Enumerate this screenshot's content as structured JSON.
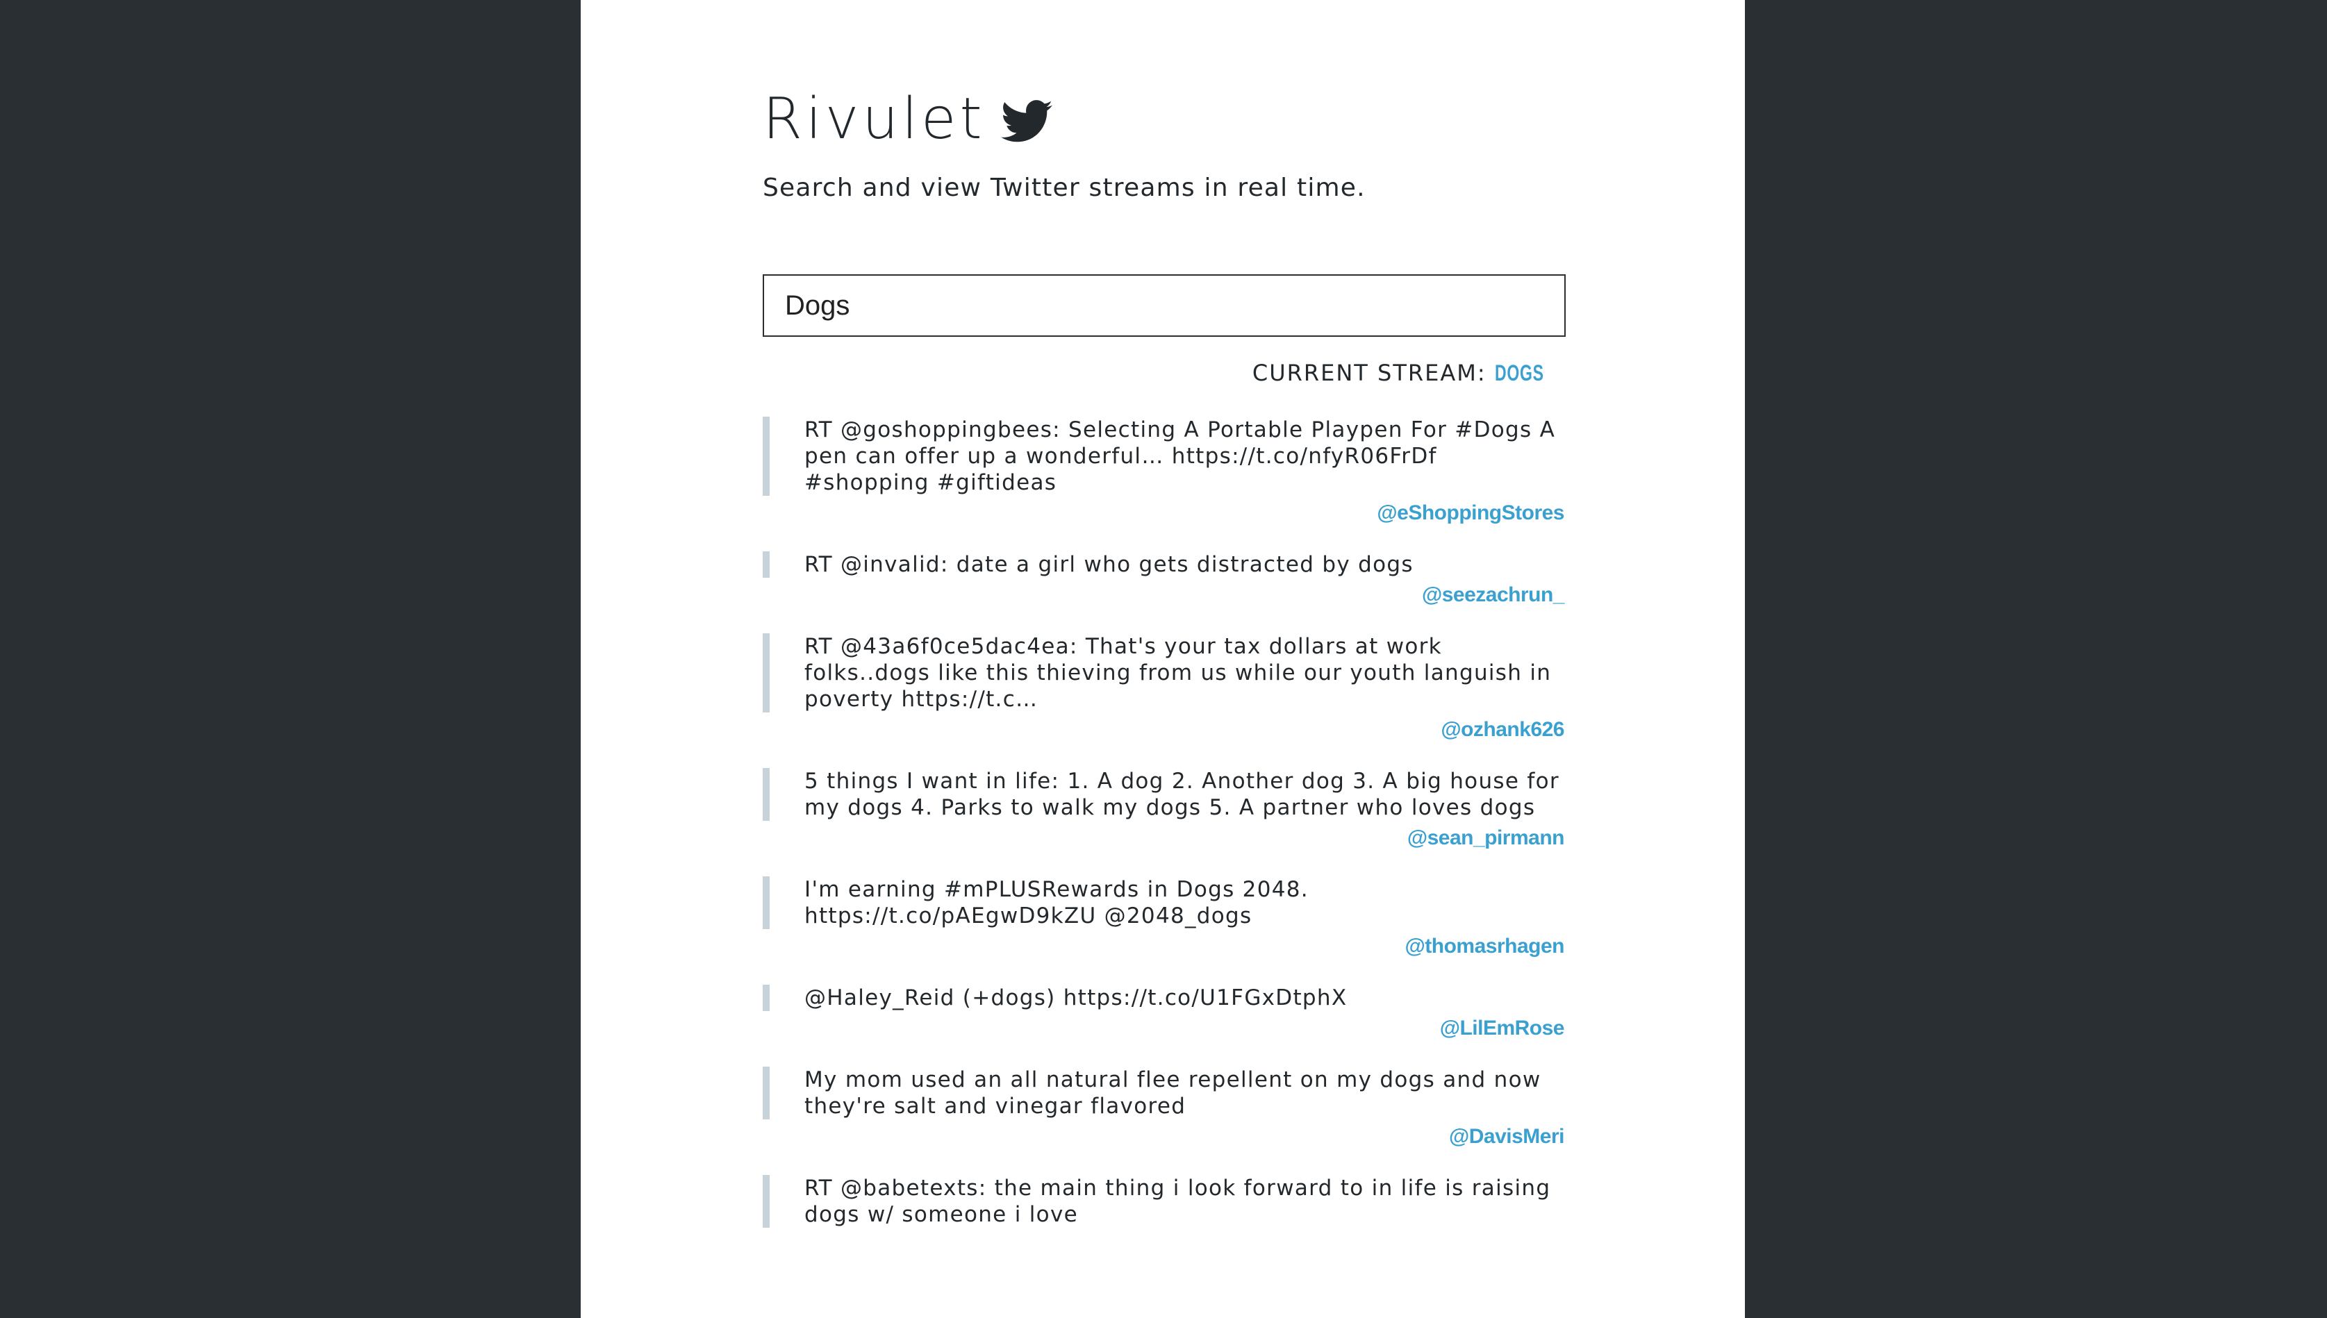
{
  "header": {
    "title": "Rivulet",
    "icon": "twitter-bird-icon",
    "tagline": "Search and view Twitter streams in real time."
  },
  "search": {
    "value": "Dogs"
  },
  "stream": {
    "label": "CURRENT STREAM:",
    "name": "DOGS"
  },
  "colors": {
    "background": "#2a2f33",
    "accent": "#3aa0d0",
    "quote_bar": "#c8d3d9"
  },
  "tweets": [
    {
      "text": "RT @goshoppingbees: Selecting A Portable Playpen For #Dogs A pen can offer up a wonderful… https://t.co/nfyR06FrDf #shopping #giftideas",
      "user": "@eShoppingStores"
    },
    {
      "text": "RT @invalid: date a girl who gets distracted by dogs",
      "user": "@seezachrun_"
    },
    {
      "text": "RT @43a6f0ce5dac4ea: That's your tax dollars at work folks..dogs like this thieving from us while our youth languish in poverty https://t.c…",
      "user": "@ozhank626"
    },
    {
      "text": "5 things I want in life: 1. A dog 2. Another dog 3. A big house for my dogs 4. Parks to walk my dogs 5. A partner who loves dogs",
      "user": "@sean_pirmann"
    },
    {
      "text": "I'm earning #mPLUSRewards in Dogs 2048. https://t.co/pAEgwD9kZU @2048_dogs",
      "user": "@thomasrhagen"
    },
    {
      "text": "@Haley_Reid (+dogs) https://t.co/U1FGxDtphX",
      "user": "@LilEmRose"
    },
    {
      "text": "My mom used an all natural flee repellent on my dogs and now they're salt and vinegar flavored",
      "user": "@DavisMeri"
    },
    {
      "text": "RT @babetexts: the main thing i look forward to in life is raising dogs w/ someone i love",
      "user": ""
    }
  ]
}
